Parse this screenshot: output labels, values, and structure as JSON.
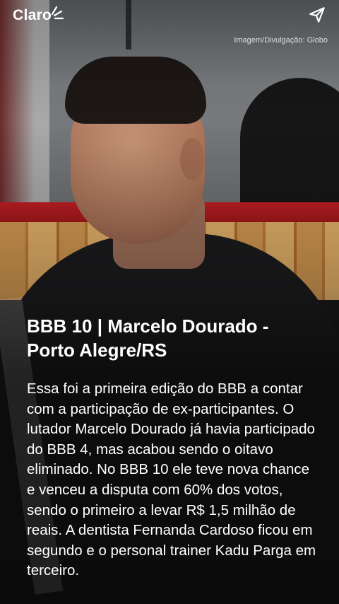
{
  "header": {
    "brand": "Claro",
    "logo_icon": "claro-logo-rays",
    "share_icon": "share-send-icon",
    "credit": "Imagem/Divulgação: Globo"
  },
  "story": {
    "title": "BBB 10 | Marcelo Dourado - Porto Alegre/RS",
    "body": "Essa foi a primeira edição do BBB a contar com a participação de ex-participantes. O lutador Marcelo Dourado já havia participado do BBB 4, mas acabou sendo o oitavo eliminado. No BBB 10 ele teve nova chance e venceu a disputa com 60% dos votos, sendo o primeiro a levar R$ 1,5 milhão de reais. A dentista Fernanda Cardoso ficou em segundo e o personal trainer Kadu Parga em terceiro."
  },
  "colors": {
    "accent_red": "#c01f23",
    "text": "#ffffff"
  }
}
